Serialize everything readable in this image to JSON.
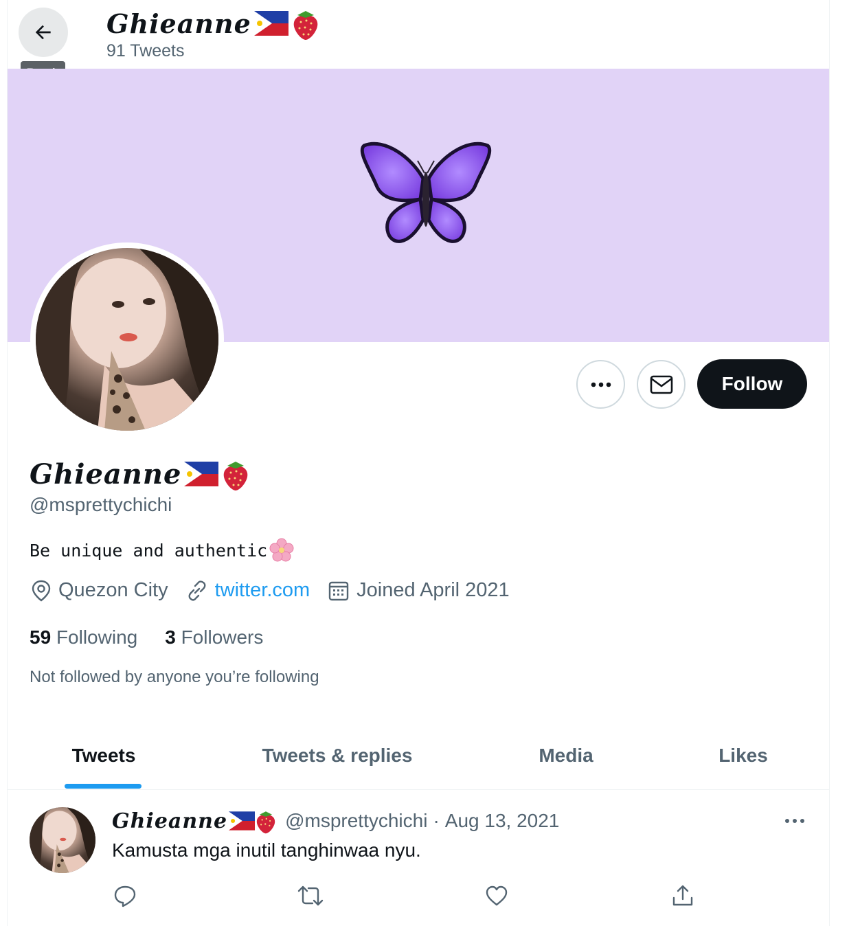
{
  "header": {
    "back_tooltip": "Back",
    "display_name": "Ghieanne",
    "tweet_count": "91 Tweets"
  },
  "profile": {
    "display_name": "Ghieanne",
    "handle": "@msprettychichi",
    "bio": "Be unique and authentic",
    "location": "Quezon City",
    "website": "twitter.com",
    "joined": "Joined April 2021",
    "following_count": "59",
    "following_label": "Following",
    "followers_count": "3",
    "followers_label": "Followers",
    "not_followed": "Not followed by anyone you’re following"
  },
  "actions": {
    "follow_label": "Follow"
  },
  "tabs": [
    {
      "label": "Tweets",
      "active": true
    },
    {
      "label": "Tweets & replies"
    },
    {
      "label": "Media"
    },
    {
      "label": "Likes"
    }
  ],
  "tweet": {
    "display_name": "Ghieanne",
    "handle": "@msprettychichi",
    "separator": "·",
    "date": "Aug 13, 2021",
    "text": "Kamusta mga inutil tanghinwaa nyu."
  },
  "colors": {
    "banner": "#e1d3f7",
    "accent": "#1d9bf0",
    "follow_bg": "#0f1419"
  }
}
